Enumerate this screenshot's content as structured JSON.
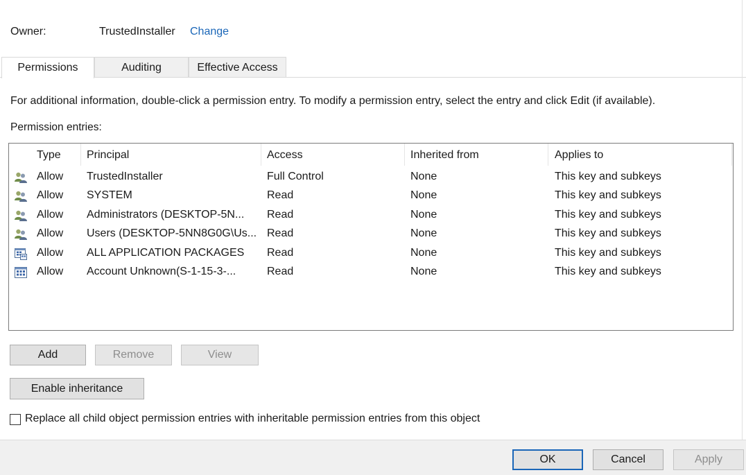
{
  "owner": {
    "label": "Owner:",
    "value": "TrustedInstaller",
    "change_link": "Change"
  },
  "tabs": [
    {
      "label": "Permissions",
      "active": true
    },
    {
      "label": "Auditing",
      "active": false
    },
    {
      "label": "Effective Access",
      "active": false
    }
  ],
  "info_text": "For additional information, double-click a permission entry. To modify a permission entry, select the entry and click Edit (if available).",
  "entries_label": "Permission entries:",
  "table": {
    "headers": [
      "Type",
      "Principal",
      "Access",
      "Inherited from",
      "Applies to"
    ],
    "rows": [
      {
        "icon": "users-icon",
        "type": "Allow",
        "principal": "TrustedInstaller",
        "access": "Full Control",
        "inherited": "None",
        "applies": "This key and subkeys"
      },
      {
        "icon": "users-icon",
        "type": "Allow",
        "principal": "SYSTEM",
        "access": "Read",
        "inherited": "None",
        "applies": "This key and subkeys"
      },
      {
        "icon": "users-icon",
        "type": "Allow",
        "principal": "Administrators (DESKTOP-5N...",
        "access": "Read",
        "inherited": "None",
        "applies": "This key and subkeys"
      },
      {
        "icon": "users-icon",
        "type": "Allow",
        "principal": "Users (DESKTOP-5NN8G0G\\Us...",
        "access": "Read",
        "inherited": "None",
        "applies": "This key and subkeys"
      },
      {
        "icon": "app-packages-icon",
        "type": "Allow",
        "principal": "ALL APPLICATION PACKAGES",
        "access": "Read",
        "inherited": "None",
        "applies": "This key and subkeys"
      },
      {
        "icon": "app-grid-icon",
        "type": "Allow",
        "principal": "Account Unknown(S-1-15-3-...",
        "access": "Read",
        "inherited": "None",
        "applies": "This key and subkeys"
      }
    ]
  },
  "buttons": {
    "add": "Add",
    "remove": "Remove",
    "view": "View",
    "enable_inheritance": "Enable inheritance",
    "ok": "OK",
    "cancel": "Cancel",
    "apply": "Apply"
  },
  "replace_checkbox": {
    "label": "Replace all child object permission entries with inheritable permission entries from this object",
    "checked": false
  },
  "colors": {
    "link": "#1a66b8",
    "focus_border": "#1a66b8",
    "button_bg": "#e1e1e1",
    "footer_bg": "#f0f0f0"
  }
}
